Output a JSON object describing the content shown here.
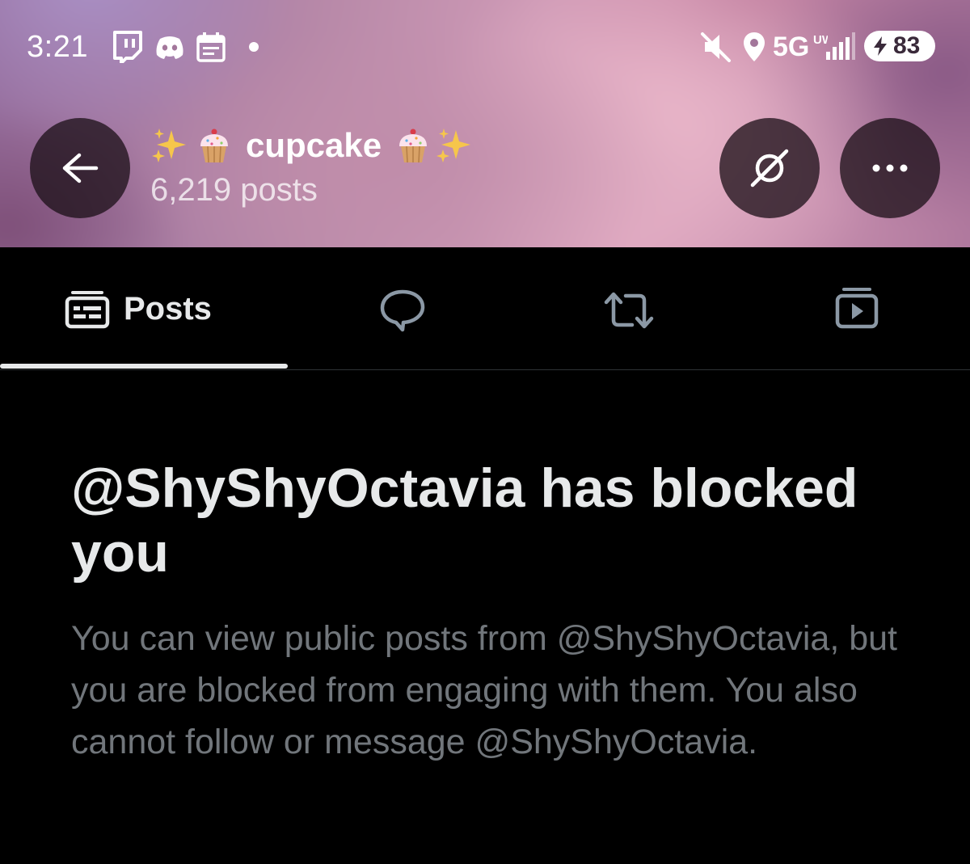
{
  "status_bar": {
    "time": "3:21",
    "app_icons": [
      "twitch-icon",
      "discord-icon",
      "calendar-icon"
    ],
    "system_icons": [
      "mute-icon",
      "location-icon",
      "signal-icon"
    ],
    "network": "5G",
    "network_sub": "UW",
    "battery_level": "83",
    "battery_charging": true
  },
  "header": {
    "back_icon": "arrow-left-icon",
    "name": "cupcake",
    "name_decorations": [
      "sparkles",
      "cupcake",
      "cupcake",
      "sparkles"
    ],
    "post_count": "6,219 posts",
    "grok_icon": "grok-icon",
    "more_icon": "more-horizontal-icon"
  },
  "tabs": [
    {
      "label": "Posts",
      "icon": "posts-icon",
      "selected": true
    },
    {
      "label": "",
      "icon": "replies-icon",
      "selected": false
    },
    {
      "label": "",
      "icon": "reposts-icon",
      "selected": false
    },
    {
      "label": "",
      "icon": "media-icon",
      "selected": false
    }
  ],
  "blocked": {
    "title": "@ShyShyOctavia has blocked you",
    "description": "You can view public posts from @ShyShyOctavia, but you are blocked from engaging with them. You also cannot follow or message @ShyShyOctavia."
  },
  "colors": {
    "background": "#000000",
    "primary_text": "#e7e9ea",
    "secondary_text": "#71767b",
    "divider": "#2f3336"
  }
}
